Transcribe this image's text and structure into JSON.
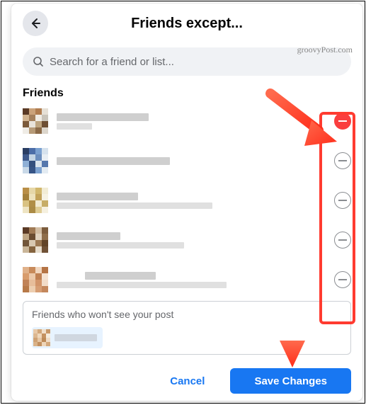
{
  "header": {
    "title": "Friends except..."
  },
  "watermark": "groovyPost.com",
  "search": {
    "placeholder": "Search for a friend or list..."
  },
  "section_label": "Friends",
  "friends": [
    {
      "excluded": true
    },
    {
      "excluded": false
    },
    {
      "excluded": false
    },
    {
      "excluded": false
    },
    {
      "excluded": false
    }
  ],
  "excluded_box": {
    "label": "Friends who won't see your post"
  },
  "footer": {
    "cancel": "Cancel",
    "save": "Save Changes"
  }
}
